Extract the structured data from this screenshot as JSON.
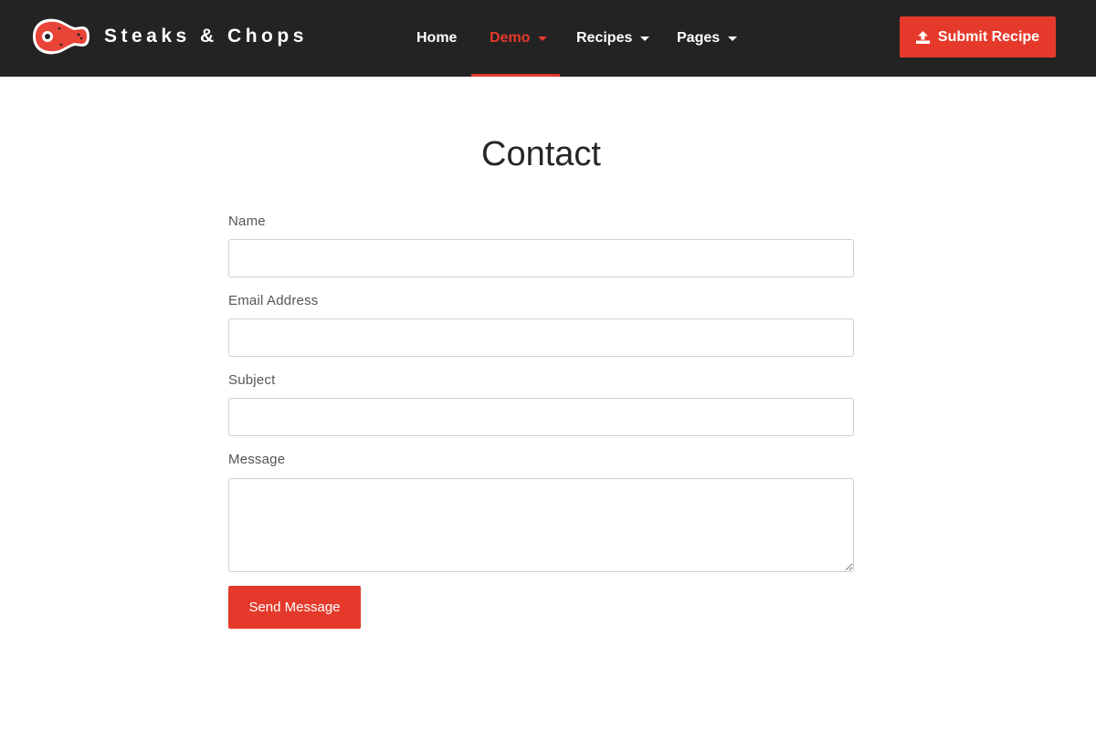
{
  "brand": {
    "name": "Steaks & Chops",
    "logo_icon": "steak-icon"
  },
  "nav": {
    "items": [
      {
        "label": "Home",
        "dropdown": false,
        "active": false
      },
      {
        "label": "Demo",
        "dropdown": true,
        "active": true
      },
      {
        "label": "Recipes",
        "dropdown": true,
        "active": false
      },
      {
        "label": "Pages",
        "dropdown": true,
        "active": false
      }
    ],
    "submit_label": "Submit Recipe",
    "submit_icon": "upload-icon"
  },
  "page": {
    "title": "Contact"
  },
  "form": {
    "name_label": "Name",
    "name_value": "",
    "email_label": "Email Address",
    "email_value": "",
    "subject_label": "Subject",
    "subject_value": "",
    "message_label": "Message",
    "message_value": "",
    "send_label": "Send Message"
  },
  "colors": {
    "accent": "#e53a2b",
    "navbar_bg": "#232323",
    "page_bg": "#ffffff"
  }
}
